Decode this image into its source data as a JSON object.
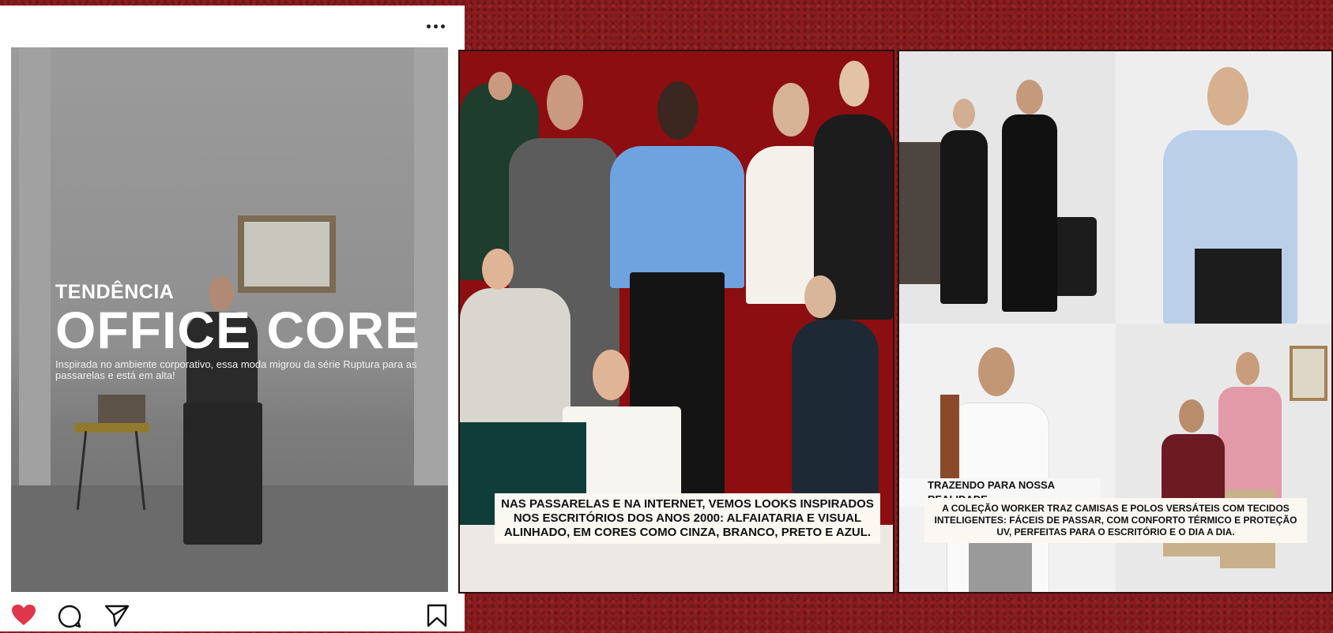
{
  "post": {
    "more_icon": "more-horizontal-icon",
    "image": {
      "kicker": "TENDÊNCIA",
      "headline": "OFFICE CORE",
      "description": "Inspirada no ambiente corporativo, essa moda migrou da série Ruptura para as passarelas e está em alta!"
    },
    "actions": {
      "like_icon": "heart-icon",
      "like_color": "#e0364c",
      "comment_icon": "comment-icon",
      "share_icon": "send-icon",
      "save_icon": "bookmark-icon"
    }
  },
  "collage_middle": {
    "background_color": "#8d0e10",
    "caption": "NAS PASSARELAS E NA INTERNET, VEMOS LOOKS INSPIRADOS NOS ESCRITÓRIOS DOS ANOS 2000: ALFAIATARIA E VISUAL ALINHADO, EM CORES COMO CINZA, BRANCO, PRETO E AZUL."
  },
  "collage_right": {
    "label": "TRAZENDO PARA NOSSA REALIDADE",
    "caption": "A COLEÇÃO WORKER TRAZ CAMISAS E POLOS VERSÁTEIS COM TECIDOS INTELIGENTES: FÁCEIS DE PASSAR, COM CONFORTO TÉRMICO E PROTEÇÃO UV, PERFEITAS PARA O ESCRITÓRIO E O DIA A DIA."
  }
}
